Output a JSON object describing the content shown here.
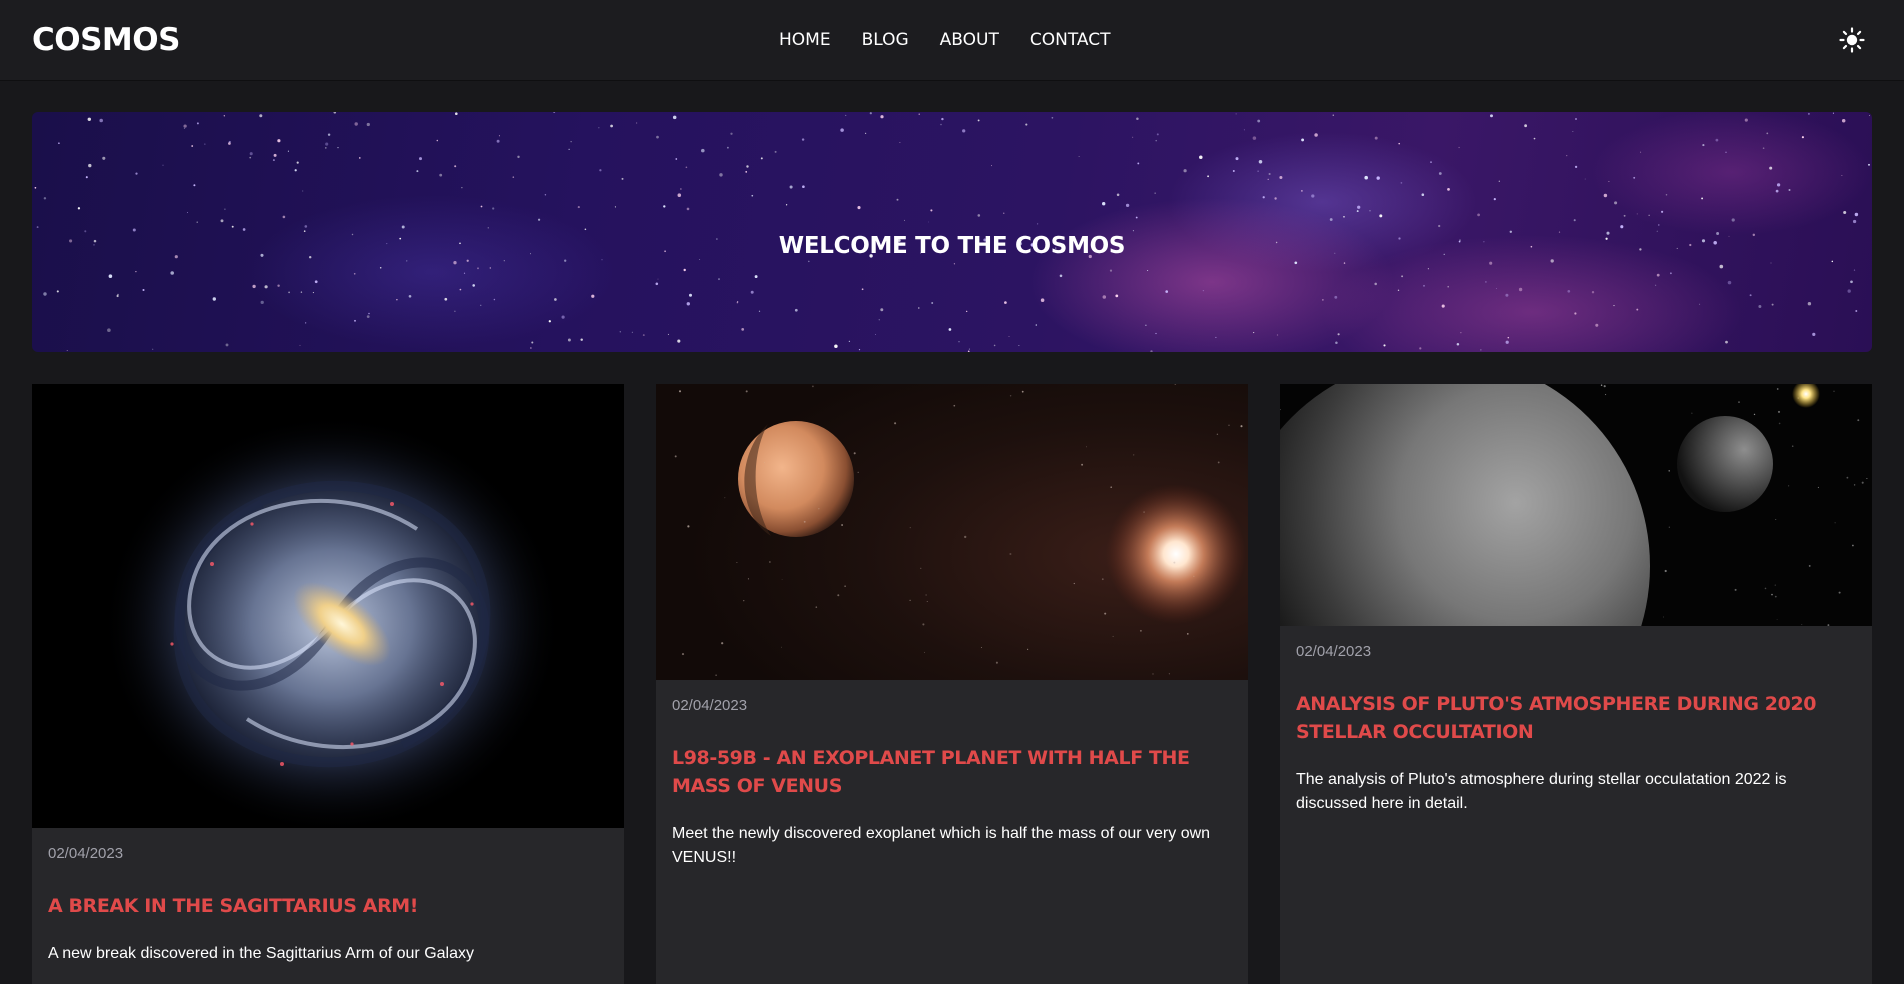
{
  "navbar": {
    "logo": "COSMOS",
    "links": [
      "HOME",
      "BLOG",
      "ABOUT",
      "CONTACT"
    ],
    "theme_toggle_icon": "sun-icon"
  },
  "hero": {
    "title": "WELCOME TO THE COSMOS"
  },
  "posts": [
    {
      "date": "02/04/2023",
      "title": "A BREAK IN THE SAGITTARIUS ARM!",
      "description": "A new break discovered in the Sagittarius Arm of our Galaxy",
      "image": "milky-way-galaxy-image"
    },
    {
      "date": "02/04/2023",
      "title": "L98-59B - AN EXOPLANET PLANET WITH HALF THE MASS OF VENUS",
      "description": "Meet the newly discovered exoplanet which is half the mass of our very own VENUS!!",
      "image": "exoplanet-and-star-image"
    },
    {
      "date": "02/04/2023",
      "title": "ANALYSIS OF PLUTO'S ATMOSPHERE DURING 2020 STELLAR OCCULTATION",
      "description": "The analysis of Pluto's atmosphere during stellar occulatation 2022 is discussed here in detail.",
      "image": "pluto-and-charon-image"
    }
  ],
  "colors": {
    "page_background": "#18181b",
    "navbar_background": "#1c1c1f",
    "card_background": "#27272a",
    "title_accent": "#e04a4a",
    "date_text": "#a1a1aa"
  }
}
